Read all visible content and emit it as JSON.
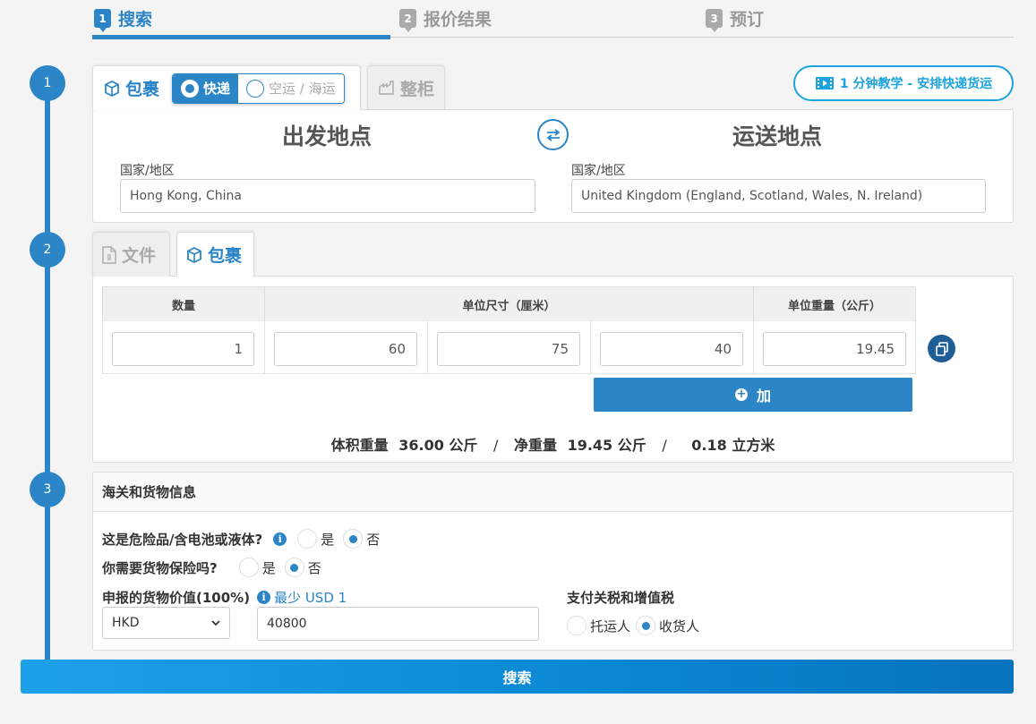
{
  "steps": [
    {
      "num": "1",
      "label": "搜索"
    },
    {
      "num": "2",
      "label": "报价结果"
    },
    {
      "num": "3",
      "label": "预订"
    }
  ],
  "timeline": [
    "1",
    "2",
    "3"
  ],
  "shipment_type": {
    "tab_parcel": "包裹",
    "tab_container": "整柜",
    "mode_express": "快递",
    "mode_air_sea": "空运 / 海运",
    "tutorial": "1 分钟教学 - 安排快递货运"
  },
  "origin": {
    "title": "出发地点",
    "country_label": "国家/地区",
    "country_value": "Hong Kong, China"
  },
  "destination": {
    "title": "运送地点",
    "country_label": "国家/地区",
    "country_value": "United Kingdom (England, Scotland, Wales, N. Ireland)"
  },
  "package_tabs": {
    "documents": "文件",
    "parcel": "包裹"
  },
  "package_table": {
    "headers": {
      "quantity": "数量",
      "dimensions": "单位尺寸（厘米）",
      "weight": "单位重量（公斤）"
    },
    "row": {
      "quantity": "1",
      "length": "60",
      "width": "75",
      "height": "40",
      "weight": "19.45"
    },
    "add_label": "加"
  },
  "summary": {
    "vol_label": "体积重量",
    "vol_value": "36.00 公斤",
    "net_label": "净重量",
    "net_value": "19.45 公斤",
    "cbm_value": "0.18 立方米",
    "separator": "/"
  },
  "customs": {
    "title": "海关和货物信息",
    "dangerous_q": "这是危险品/含电池或液体?",
    "insurance_q": "你需要货物保险吗?",
    "yes": "是",
    "no": "否",
    "declared_label": "申报的货物价值(100%)",
    "min_hint": "最少 USD 1",
    "currency": "HKD",
    "declared_value": "40800",
    "duties_label": "支付关税和增值税",
    "shipper": "托运人",
    "consignee": "收货人"
  },
  "search_button": "搜索",
  "colors": {
    "primary": "#2b85c6",
    "accent": "#1ba3dd"
  }
}
